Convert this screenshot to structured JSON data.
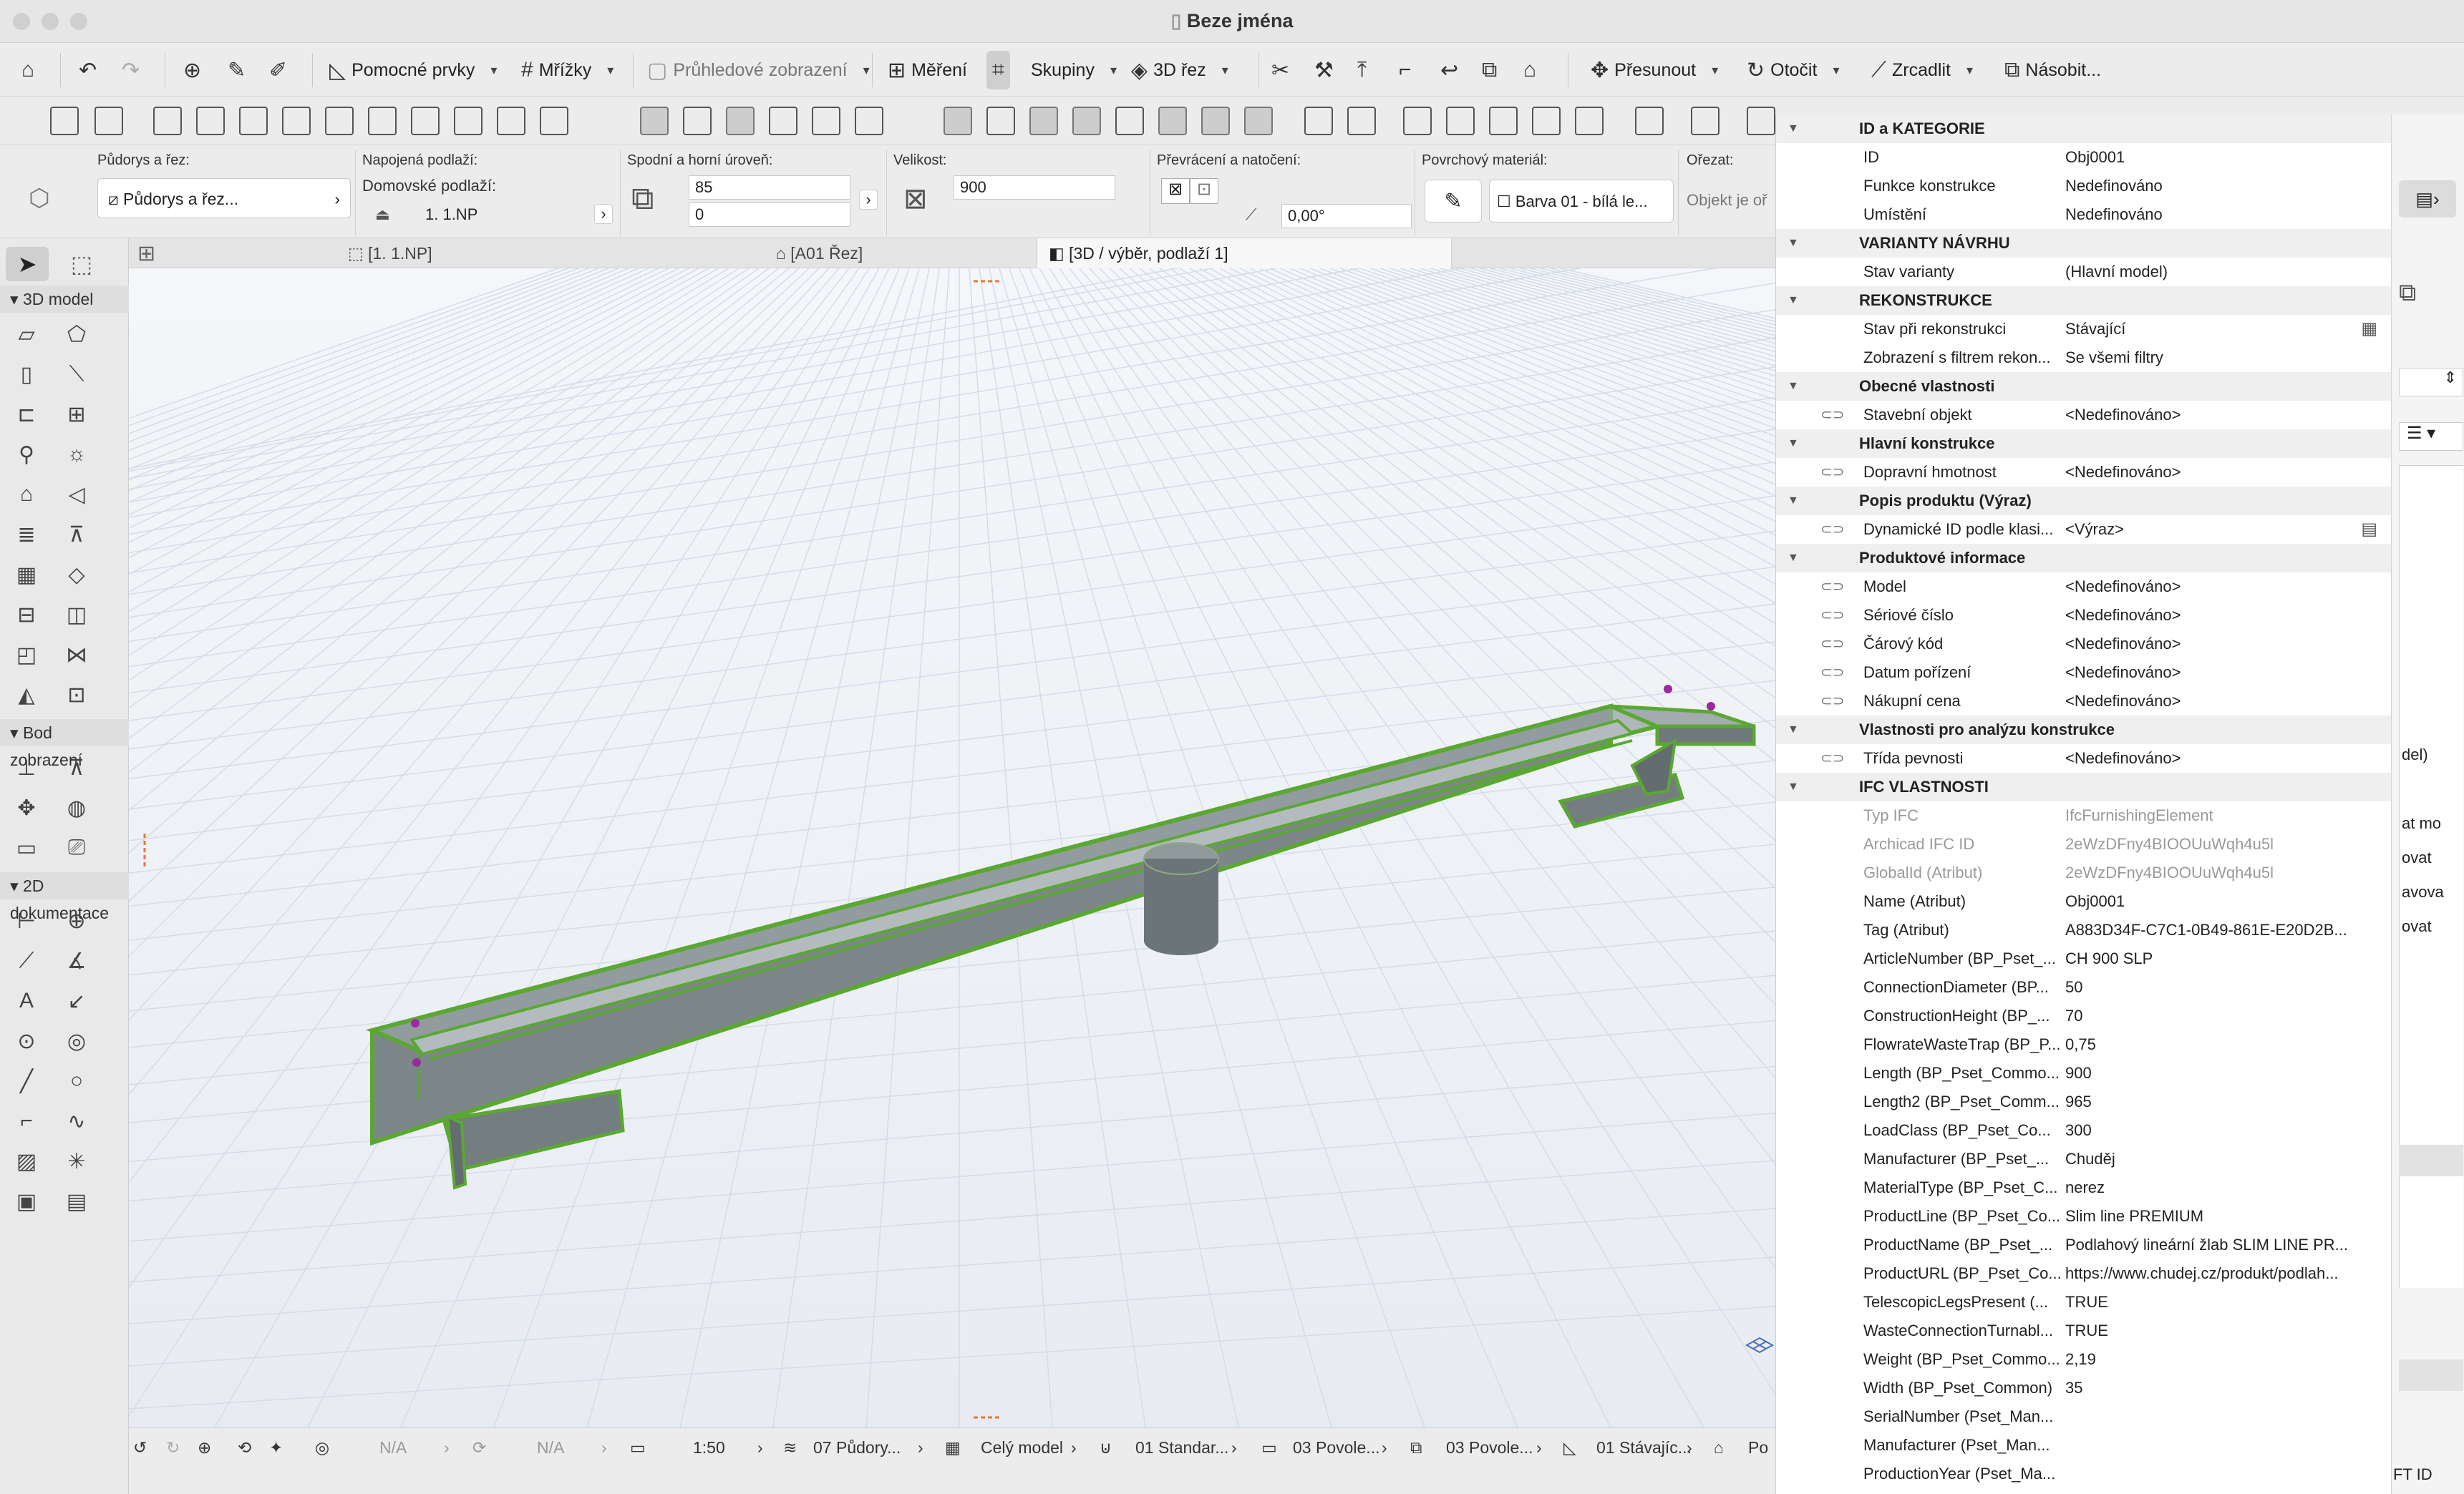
{
  "window": {
    "title": "Beze jména"
  },
  "toolbar": {
    "pomocne_prvky": "Pomocné prvky",
    "mrizky": "Mřížky",
    "pruhledove_zobrazeni": "Průhledové zobrazení",
    "mereni": "Měření",
    "skupiny": "Skupiny",
    "rez3d": "3D řez",
    "presunout": "Přesunout",
    "otocit": "Otočit",
    "zrcadlit": "Zrcadlit",
    "nasobit": "Násobit..."
  },
  "infobox": {
    "pudorys_label": "Půdorys a řez:",
    "pudorys_button": "Půdorys a řez...",
    "napojena_label": "Napojená podlaží:",
    "domovske_label": "Domovské podlaží:",
    "domovske_value": "1. 1.NP",
    "urovne_label": "Spodní a horní úroveň:",
    "horni": "85",
    "spodni": "0",
    "velikost_label": "Velikost:",
    "velikost": "900",
    "prevraceni_label": "Převrácení a natočení:",
    "uhel": "0,00°",
    "material_label": "Povrchový materiál:",
    "material": "Barva 01 - bílá le...",
    "orezat_label": "Ořezat:",
    "orezat_value": "Objekt je oř"
  },
  "toolbox": {
    "section1": "3D model",
    "section2": "Bod zobrazení",
    "section3": "2D dokumentace"
  },
  "tabs": [
    {
      "label": "[1. 1.NP]"
    },
    {
      "label": "[A01 Řez]"
    },
    {
      "label": "[3D / výběr, podlaží 1]"
    }
  ],
  "statusbar": {
    "na1": "N/A",
    "na2": "N/A",
    "scale": "1:50",
    "layer": "07 Půdory...",
    "model": "Celý model",
    "pen": "01 Standar...",
    "view1": "03 Povole...",
    "view2": "03 Povole...",
    "reno": "01 Stávajíc...",
    "more": "Po"
  },
  "properties": [
    {
      "type": "group",
      "name": "ID a KATEGORIE"
    },
    {
      "type": "row",
      "name": "ID",
      "value": "Obj0001"
    },
    {
      "type": "row",
      "name": "Funkce konstrukce",
      "value": "Nedefinováno"
    },
    {
      "type": "row",
      "name": "Umístění",
      "value": "Nedefinováno"
    },
    {
      "type": "group",
      "name": "VARIANTY NÁVRHU"
    },
    {
      "type": "row",
      "name": "Stav varianty",
      "value": "(Hlavní model)"
    },
    {
      "type": "group",
      "name": "REKONSTRUKCE"
    },
    {
      "type": "row",
      "name": "Stav při rekonstrukci",
      "value": "Stávající",
      "icon": "brick"
    },
    {
      "type": "row",
      "name": "Zobrazení s filtrem rekon...",
      "value": "Se všemi filtry"
    },
    {
      "type": "group",
      "name": "Obecné vlastnosti"
    },
    {
      "type": "row",
      "link": true,
      "name": "Stavební objekt",
      "value": "<Nedefinováno>"
    },
    {
      "type": "group",
      "name": "Hlavní konstrukce"
    },
    {
      "type": "row",
      "link": true,
      "name": "Dopravní hmotnost",
      "value": "<Nedefinováno>"
    },
    {
      "type": "group",
      "name": "Popis produktu (Výraz)"
    },
    {
      "type": "row",
      "link": true,
      "name": "Dynamické ID podle klasi...",
      "value": "<Výraz>",
      "icon": "calc"
    },
    {
      "type": "group",
      "name": "Produktové informace"
    },
    {
      "type": "row",
      "link": true,
      "name": "Model",
      "value": "<Nedefinováno>"
    },
    {
      "type": "row",
      "link": true,
      "name": "Sériové číslo",
      "value": "<Nedefinováno>"
    },
    {
      "type": "row",
      "link": true,
      "name": "Čárový kód",
      "value": "<Nedefinováno>"
    },
    {
      "type": "row",
      "link": true,
      "name": "Datum pořízení",
      "value": "<Nedefinováno>"
    },
    {
      "type": "row",
      "link": true,
      "name": "Nákupní cena",
      "value": "<Nedefinováno>"
    },
    {
      "type": "group",
      "name": "Vlastnosti pro analýzu konstrukce"
    },
    {
      "type": "row",
      "link": true,
      "name": "Třída pevnosti",
      "value": "<Nedefinováno>"
    },
    {
      "type": "group",
      "name": "IFC VLASTNOSTI"
    },
    {
      "type": "row",
      "dim": true,
      "name": "Typ IFC",
      "value": "IfcFurnishingElement"
    },
    {
      "type": "row",
      "dim": true,
      "name": "Archicad IFC ID",
      "value": "2eWzDFny4BIOOUuWqh4u5l"
    },
    {
      "type": "row",
      "dim": true,
      "name": "GlobalId (Atribut)",
      "value": "2eWzDFny4BIOOUuWqh4u5l"
    },
    {
      "type": "row",
      "name": "Name (Atribut)",
      "value": "Obj0001"
    },
    {
      "type": "row",
      "name": "Tag (Atribut)",
      "value": "A883D34F-C7C1-0B49-861E-E20D2B..."
    },
    {
      "type": "row",
      "name": "ArticleNumber (BP_Pset_...",
      "value": "CH 900 SLP"
    },
    {
      "type": "row",
      "name": "ConnectionDiameter (BP...",
      "value": " 50"
    },
    {
      "type": "row",
      "name": "ConstructionHeight (BP_...",
      "value": " 70"
    },
    {
      "type": "row",
      "name": "FlowrateWasteTrap (BP_P...",
      "value": " 0,75"
    },
    {
      "type": "row",
      "name": "Length (BP_Pset_Commo...",
      "value": " 900"
    },
    {
      "type": "row",
      "name": "Length2 (BP_Pset_Comm...",
      "value": " 965"
    },
    {
      "type": "row",
      "name": "LoadClass (BP_Pset_Co...",
      "value": " 300"
    },
    {
      "type": "row",
      "name": "Manufacturer (BP_Pset_...",
      "value": "Chuděj"
    },
    {
      "type": "row",
      "name": "MaterialType (BP_Pset_C...",
      "value": "nerez"
    },
    {
      "type": "row",
      "name": "ProductLine (BP_Pset_Co...",
      "value": "Slim line PREMIUM"
    },
    {
      "type": "row",
      "name": "ProductName (BP_Pset_...",
      "value": "Podlahový lineární žlab SLIM LINE PR..."
    },
    {
      "type": "row",
      "name": "ProductURL (BP_Pset_Co...",
      "value": "https://www.chudej.cz/produkt/podlah..."
    },
    {
      "type": "row",
      "name": "TelescopicLegsPresent (...",
      "value": "TRUE"
    },
    {
      "type": "row",
      "name": "WasteConnectionTurnabl...",
      "value": "TRUE"
    },
    {
      "type": "row",
      "name": "Weight (BP_Pset_Commo...",
      "value": " 2,19"
    },
    {
      "type": "row",
      "name": "Width (BP_Pset_Common)",
      "value": " 35"
    },
    {
      "type": "row",
      "name": "SerialNumber (Pset_Man...",
      "value": ""
    },
    {
      "type": "row",
      "name": "Manufacturer (Pset_Man...",
      "value": ""
    },
    {
      "type": "row",
      "name": "ProductionYear (Pset_Ma...",
      "value": ""
    }
  ],
  "rightstrip": {
    "t1": "del)",
    "t2": "at mo",
    "t3": "ovat",
    "t4": "avova",
    "t5": "ovat",
    "bottom": "FT ID"
  },
  "colors": {
    "accent_green": "#5aa832",
    "object_gray": "#7f8a8d",
    "grid_line": "#d5dce7"
  }
}
